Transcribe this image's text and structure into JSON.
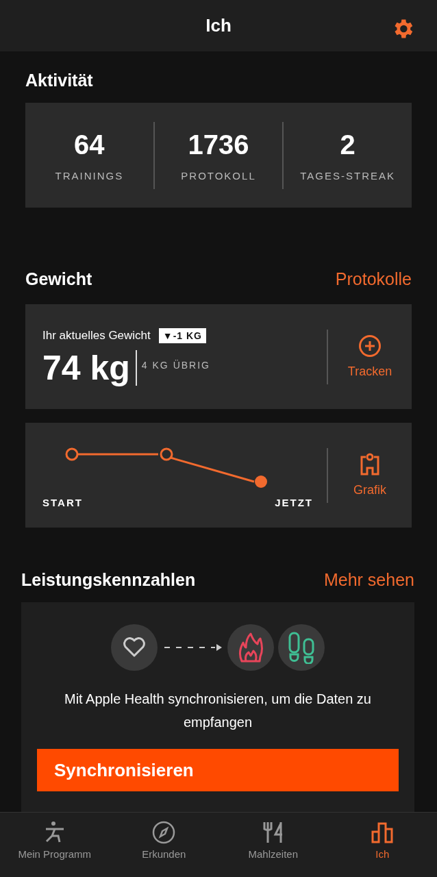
{
  "header": {
    "title": "Ich"
  },
  "activity": {
    "title": "Aktivität",
    "stats": [
      {
        "value": "64",
        "label": "TRAININGS"
      },
      {
        "value": "1736",
        "label": "PROTOKOLL"
      },
      {
        "value": "2",
        "label": "TAGES-STREAK"
      }
    ]
  },
  "weight": {
    "title": "Gewicht",
    "link": "Protokolle",
    "current_label": "Ihr aktuelles Gewicht",
    "change_badge": "▼-1 KG",
    "value": "74 kg",
    "remaining": "4 KG ÜBRIG",
    "track_button": "Tracken",
    "start_label": "START",
    "now_label": "JETZT",
    "graph_button": "Grafik"
  },
  "performance": {
    "title": "Leistungskennzahlen",
    "link": "Mehr sehen",
    "message": "Mit Apple Health synchronisieren, um die Daten zu empfangen",
    "sync_button": "Synchronisieren"
  },
  "tabs": [
    {
      "label": "Mein Programm",
      "kind": "figure",
      "selected": false
    },
    {
      "label": "Erkunden",
      "kind": "compass",
      "selected": false
    },
    {
      "label": "Mahlzeiten",
      "kind": "fork",
      "selected": false
    },
    {
      "label": "Ich",
      "kind": "bars",
      "selected": true
    }
  ]
}
